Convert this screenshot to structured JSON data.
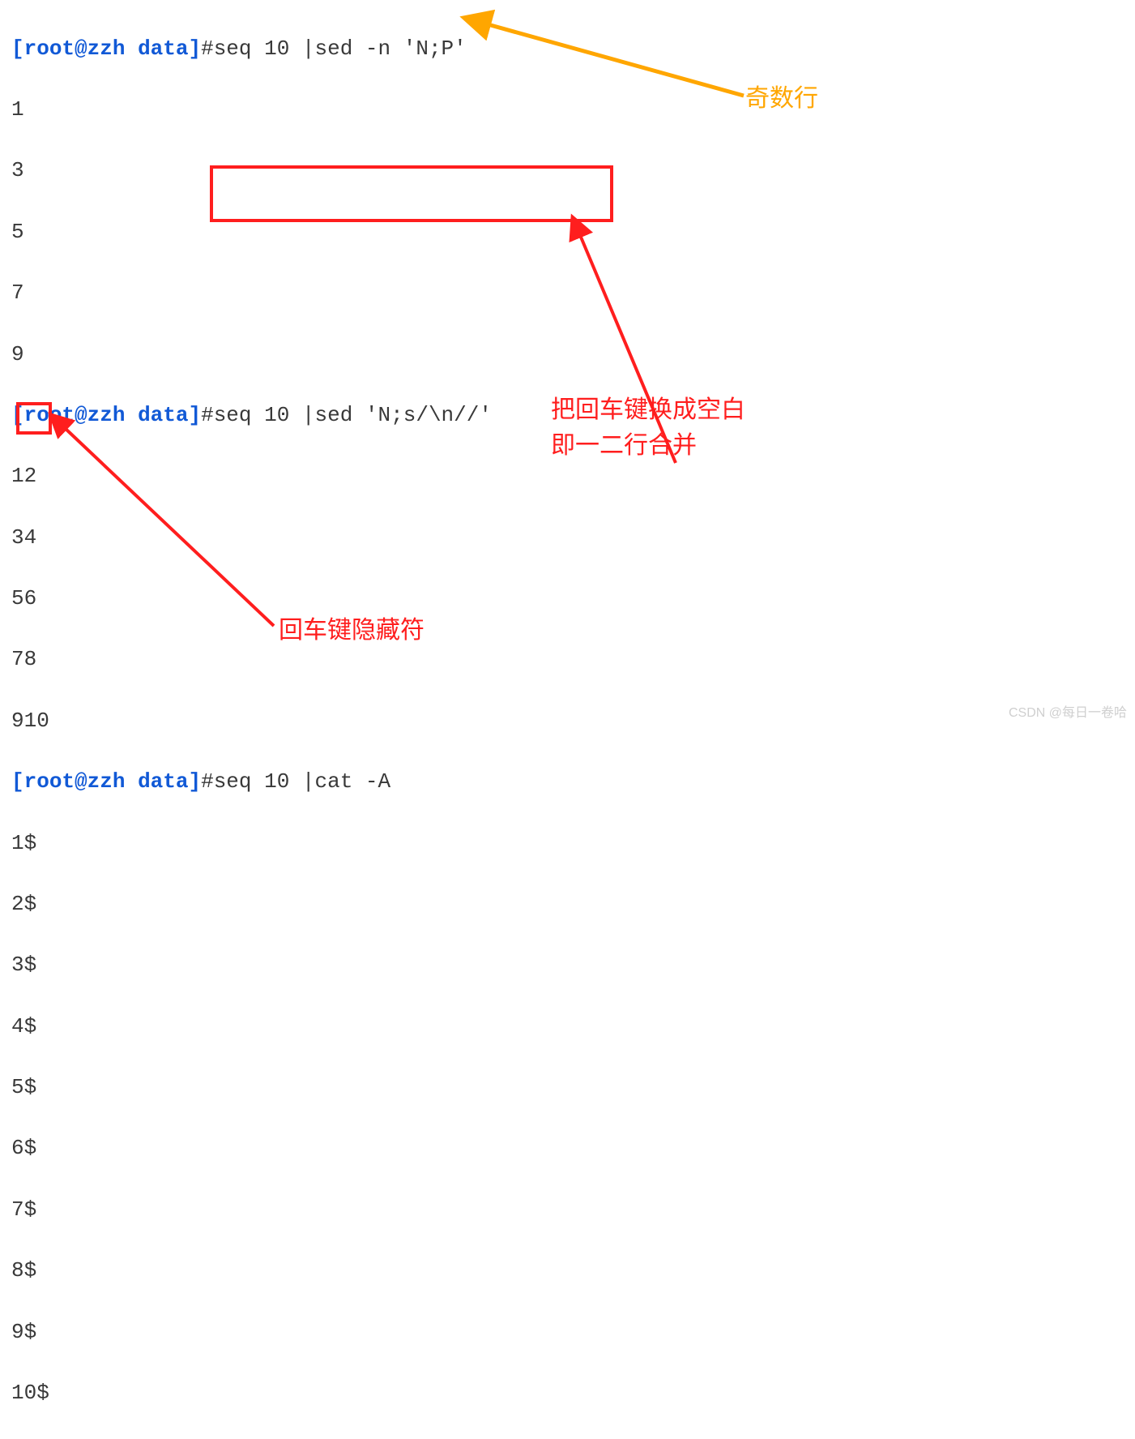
{
  "prompt": {
    "user": "root",
    "host": "zzh",
    "path": "data",
    "ps1_open": "[",
    "ps1_at": "@",
    "ps1_close": "]",
    "hash": "#"
  },
  "blocks": [
    {
      "cmd": "seq 10 |sed -n 'N;P'",
      "output": [
        "1",
        "3",
        "5",
        "7",
        "9"
      ]
    },
    {
      "cmd": "seq 10 |sed 'N;s/\\n//'",
      "output": [
        "12",
        "34",
        "56",
        "78",
        "910"
      ]
    },
    {
      "cmd": "seq 10 |cat -A",
      "output": [
        "1$",
        "2$",
        "3$",
        "4$",
        "5$",
        "6$",
        "7$",
        "8$",
        "9$",
        "10$"
      ]
    }
  ],
  "annotations": {
    "orange": "奇数行",
    "red1": "把回车键换成空白\n即一二行合并",
    "red2": "回车键隐藏符"
  },
  "watermark": "CSDN @每日一卷哈"
}
